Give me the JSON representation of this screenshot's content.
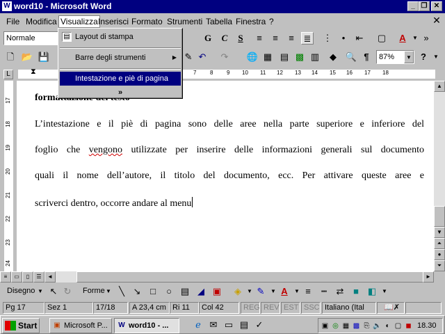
{
  "window": {
    "title": "word10 - Microsoft Word"
  },
  "menubar": [
    "File",
    "Modifica",
    "Visualizza",
    "Inserisci",
    "Formato",
    "Strumenti",
    "Tabella",
    "Finestra",
    "?"
  ],
  "format_toolbar": {
    "style_value": "Normale",
    "bold_label": "G",
    "italic_label": "C",
    "underline_label": "S",
    "color_letter": "A"
  },
  "standard_toolbar": {
    "zoom_value": "87%",
    "pilcrow": "¶",
    "help": "?"
  },
  "dropdown": {
    "items": [
      {
        "label": "Layout di stampa"
      },
      {
        "label": "Barre degli strumenti"
      },
      {
        "label": "Intestazione e piè di pagina"
      }
    ],
    "more": "»"
  },
  "ruler": {
    "marks": [
      "7",
      "8",
      "9",
      "10",
      "11",
      "12",
      "13",
      "14",
      "15",
      "16",
      "17",
      "18"
    ]
  },
  "vruler": {
    "marks": [
      "17",
      "18",
      "19",
      "20",
      "21",
      "22",
      "23",
      "24"
    ]
  },
  "document": {
    "heading": "formattazione del testo",
    "lines": [
      "L’intestazione e il piè di pagina sono delle aree nella parte superiore e inferiore del",
      "foglio che vengono utilizzate per inserire delle informazioni generali sul documento",
      "quali il nome dell’autore, il titolo del documento, ecc. Per attivare queste aree e",
      "scriverci dentro, occorre andare al menu"
    ],
    "misspelled": "vengono"
  },
  "drawing_toolbar": {
    "draw_label": "Disegno",
    "shapes_label": "Forme"
  },
  "statusbar": {
    "page": "Pg 17",
    "section": "Sez 1",
    "pages": "17/18",
    "position": "A  23,4 cm",
    "line": "Ri 11",
    "column": "Col 42",
    "rec": "REG",
    "rev": "REV",
    "ext": "EST",
    "ovr": "SSC",
    "language": "Italiano (Ital"
  },
  "taskbar": {
    "start": "Start",
    "tasks": [
      "Microsoft P...",
      "word10 - ..."
    ],
    "clock": "18.30"
  }
}
